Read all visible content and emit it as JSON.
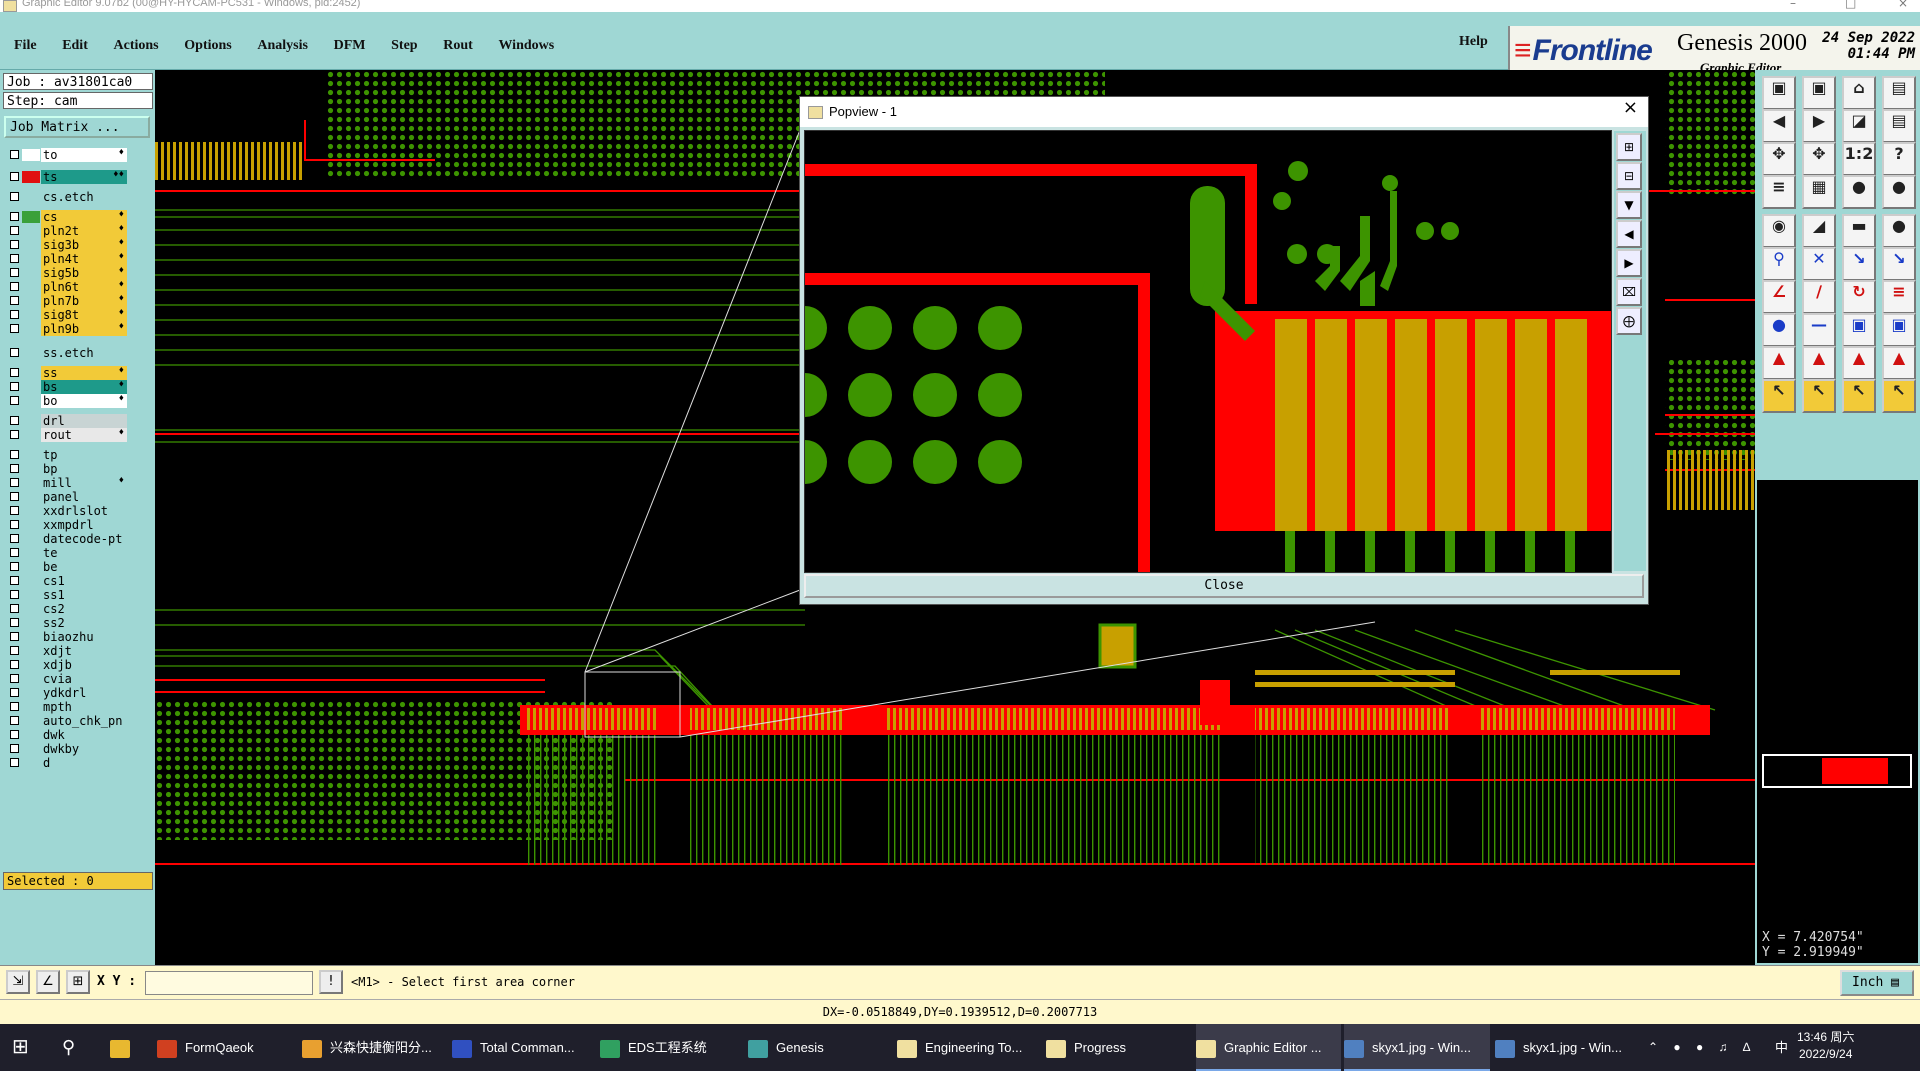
{
  "window": {
    "title": "Graphic Editor 9.07b2 (00@HY-HYCAM-PC531 - Windows, pid:2452)"
  },
  "menu": {
    "items": [
      "File",
      "Edit",
      "Actions",
      "Options",
      "Analysis",
      "DFM",
      "Step",
      "Rout",
      "Windows"
    ],
    "help": "Help"
  },
  "logo": {
    "brand": "Frontline",
    "product": "Genesis 2000",
    "subtitle": "Graphic Editor",
    "date": "24 Sep 2022",
    "time": "01:44 PM"
  },
  "job": {
    "job_line": "Job : av31801ca0",
    "step_line": "Step: cam",
    "matrix_button": "Job Matrix ..."
  },
  "layers": [
    {
      "name": "to",
      "color": "#ffffff",
      "box": "#ffffff",
      "mark": "♦"
    },
    {
      "name": "ts",
      "color": "#1e9a8a",
      "box": "#e01010",
      "mark": "♦♦"
    },
    {
      "name": "cs.etch",
      "color": "#9fd7d4",
      "box": "",
      "mark": ""
    },
    {
      "name": "cs",
      "color": "#f2ca38",
      "box": "#3aa03a",
      "mark": "♦"
    },
    {
      "name": "pln2t",
      "color": "#f2ca38",
      "box": "",
      "mark": "♦"
    },
    {
      "name": "sig3b",
      "color": "#f2ca38",
      "box": "",
      "mark": "♦"
    },
    {
      "name": "pln4t",
      "color": "#f2ca38",
      "box": "",
      "mark": "♦"
    },
    {
      "name": "sig5b",
      "color": "#f2ca38",
      "box": "",
      "mark": "♦"
    },
    {
      "name": "pln6t",
      "color": "#f2ca38",
      "box": "",
      "mark": "♦"
    },
    {
      "name": "pln7b",
      "color": "#f2ca38",
      "box": "",
      "mark": "♦"
    },
    {
      "name": "sig8t",
      "color": "#f2ca38",
      "box": "",
      "mark": "♦"
    },
    {
      "name": "pln9b",
      "color": "#f2ca38",
      "box": "",
      "mark": "♦"
    },
    {
      "name": "ss.etch",
      "color": "#9fd7d4",
      "box": "",
      "mark": ""
    },
    {
      "name": "ss",
      "color": "#f2ca38",
      "box": "",
      "mark": "♦"
    },
    {
      "name": "bs",
      "color": "#1e9a8a",
      "box": "",
      "mark": "♦"
    },
    {
      "name": "bo",
      "color": "#ffffff",
      "box": "",
      "mark": "♦"
    },
    {
      "name": "drl",
      "color": "#c8d4d4",
      "box": "",
      "mark": ""
    },
    {
      "name": "rout",
      "color": "#e8e8e8",
      "box": "",
      "mark": "♦"
    },
    {
      "name": "tp",
      "color": "#9fd7d4",
      "box": "",
      "mark": ""
    },
    {
      "name": "bp",
      "color": "#9fd7d4",
      "box": "",
      "mark": ""
    },
    {
      "name": "mill",
      "color": "#9fd7d4",
      "box": "",
      "mark": "♦"
    },
    {
      "name": "panel",
      "color": "#9fd7d4",
      "box": "",
      "mark": ""
    },
    {
      "name": "xxdrlslot",
      "color": "#9fd7d4",
      "box": "",
      "mark": ""
    },
    {
      "name": "xxmpdrl",
      "color": "#9fd7d4",
      "box": "",
      "mark": ""
    },
    {
      "name": "datecode-pt",
      "color": "#9fd7d4",
      "box": "",
      "mark": ""
    },
    {
      "name": "te",
      "color": "#9fd7d4",
      "box": "",
      "mark": ""
    },
    {
      "name": "be",
      "color": "#9fd7d4",
      "box": "",
      "mark": ""
    },
    {
      "name": "cs1",
      "color": "#9fd7d4",
      "box": "",
      "mark": ""
    },
    {
      "name": "ss1",
      "color": "#9fd7d4",
      "box": "",
      "mark": ""
    },
    {
      "name": "cs2",
      "color": "#9fd7d4",
      "box": "",
      "mark": ""
    },
    {
      "name": "ss2",
      "color": "#9fd7d4",
      "box": "",
      "mark": ""
    },
    {
      "name": "biaozhu",
      "color": "#9fd7d4",
      "box": "",
      "mark": ""
    },
    {
      "name": "xdjt",
      "color": "#9fd7d4",
      "box": "",
      "mark": ""
    },
    {
      "name": "xdjb",
      "color": "#9fd7d4",
      "box": "",
      "mark": ""
    },
    {
      "name": "cvia",
      "color": "#9fd7d4",
      "box": "",
      "mark": ""
    },
    {
      "name": "ydkdrl",
      "color": "#9fd7d4",
      "box": "",
      "mark": ""
    },
    {
      "name": "mpth",
      "color": "#9fd7d4",
      "box": "",
      "mark": ""
    },
    {
      "name": "auto_chk_pn",
      "color": "#9fd7d4",
      "box": "",
      "mark": ""
    },
    {
      "name": "dwk",
      "color": "#9fd7d4",
      "box": "",
      "mark": ""
    },
    {
      "name": "dwkby",
      "color": "#9fd7d4",
      "box": "",
      "mark": ""
    },
    {
      "name": "d",
      "color": "#9fd7d4",
      "box": "",
      "mark": ""
    }
  ],
  "selected": "Selected : 0",
  "popview": {
    "title": "Popview - 1",
    "close_label": "Close"
  },
  "coords": {
    "x": "X = 7.420754\"",
    "y": "Y = 2.919949\""
  },
  "command": {
    "xy_label": "X Y :",
    "xy_value": "",
    "prompt": "<M1> - Select first area corner",
    "units": "Inch"
  },
  "status": "DX=-0.0518849,DY=0.1939512,D=0.2007713",
  "taskbar": {
    "items": [
      "FormQaeok",
      "兴森快捷衡阳分...",
      "Total Comman...",
      "EDS工程系统",
      "Genesis",
      "Engineering To...",
      "Progress",
      "Graphic Editor ...",
      "skyx1.jpg - Win...",
      "skyx1.jpg - Win..."
    ],
    "tray": "中",
    "time": "13:46 周六",
    "date": "2022/9/24"
  },
  "colors": {
    "panel": "#9fd7d4",
    "copper": "#3d9400",
    "signal": "#ff0000",
    "gold": "#c8a000"
  }
}
